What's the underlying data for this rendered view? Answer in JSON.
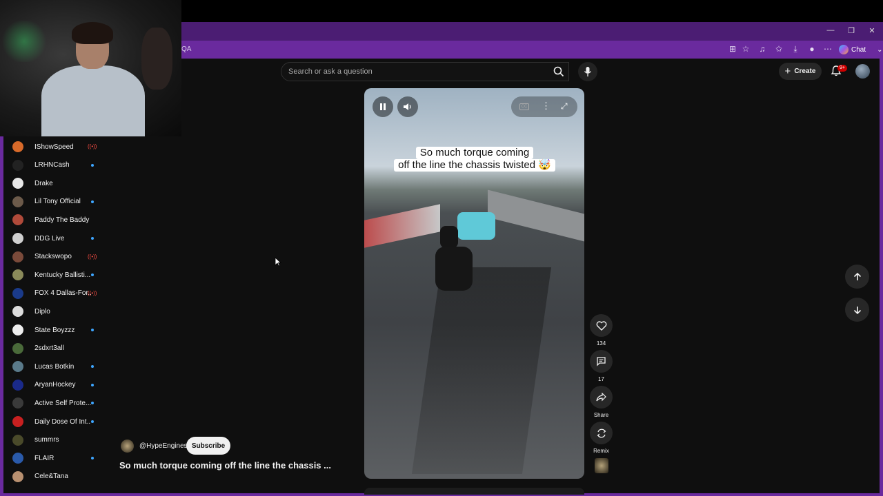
{
  "browser": {
    "address_fragment": "QA",
    "chat_label": "Chat",
    "window_controls": [
      "minimize-icon",
      "restore-icon",
      "close-icon"
    ],
    "toolbar_icons": [
      "apps-icon",
      "favorite-star-icon",
      "media-icon",
      "favorites-icon",
      "download-icon",
      "profile-icon",
      "more-icon"
    ]
  },
  "header": {
    "search_placeholder": "Search or ask a question",
    "create_label": "Create",
    "notification_badge": "9+"
  },
  "sidebar": {
    "subscriptions": [
      {
        "name": "IShowSpeed",
        "status": "live",
        "avatar_color": "#d86a2a"
      },
      {
        "name": "LRHNCash",
        "status": "new",
        "avatar_color": "#222222"
      },
      {
        "name": "Drake",
        "status": "",
        "avatar_color": "#e8e8e8"
      },
      {
        "name": "Lil Tony Official",
        "status": "new",
        "avatar_color": "#6c5a4a"
      },
      {
        "name": "Paddy The Baddy",
        "status": "",
        "avatar_color": "#b04a3a"
      },
      {
        "name": "DDG Live",
        "status": "new",
        "avatar_color": "#cfcfcf"
      },
      {
        "name": "Stackswopo",
        "status": "live",
        "avatar_color": "#7a4a3a"
      },
      {
        "name": "Kentucky Ballisti...",
        "status": "new",
        "avatar_color": "#8a8a5a"
      },
      {
        "name": "FOX 4 Dallas-For...",
        "status": "live",
        "avatar_color": "#1a3a8a"
      },
      {
        "name": "Diplo",
        "status": "",
        "avatar_color": "#dcdcdc"
      },
      {
        "name": "State Boyzzz",
        "status": "new",
        "avatar_color": "#eeeeee"
      },
      {
        "name": "2sdxrt3all",
        "status": "",
        "avatar_color": "#4a6a3a"
      },
      {
        "name": "Lucas Botkin",
        "status": "new",
        "avatar_color": "#5a7a8a"
      },
      {
        "name": "AryanHockey",
        "status": "new",
        "avatar_color": "#1a2a8a"
      },
      {
        "name": "Active Self Prote...",
        "status": "new",
        "avatar_color": "#3a3a3a"
      },
      {
        "name": "Daily Dose Of Int...",
        "status": "new",
        "avatar_color": "#c82020"
      },
      {
        "name": "summrs",
        "status": "",
        "avatar_color": "#4a4a2a"
      },
      {
        "name": "FLAIR",
        "status": "new",
        "avatar_color": "#2a5aaa"
      },
      {
        "name": "Cele&Tana",
        "status": "",
        "avatar_color": "#b89070"
      }
    ],
    "live_glyph": "((•))"
  },
  "video": {
    "caption_line1": "So much torque coming",
    "caption_line2": "off the line the chassis twisted 🤯"
  },
  "actions": {
    "likes": "134",
    "comments": "17",
    "share_label": "Share",
    "remix_label": "Remix"
  },
  "channel": {
    "handle": "@HypeEngines",
    "subscribe_label": "Subscribe",
    "title": "So much torque coming off the line the chassis ..."
  },
  "colors": {
    "browser_frame": "#6a2a9e",
    "background": "#0f0f0f",
    "live": "#ff4e45",
    "new_dot": "#3ea6ff"
  }
}
